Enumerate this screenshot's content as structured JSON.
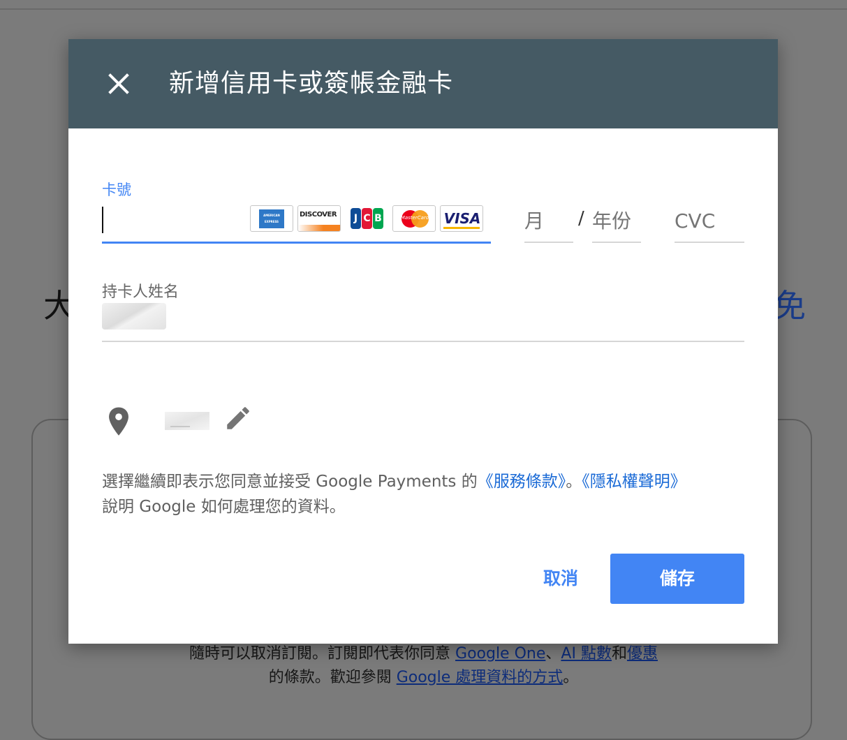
{
  "background": {
    "heading_left": "大",
    "heading_right": "免",
    "footer_line1_prefix": "隨時可以取消訂閱。訂閱即代表你同意 ",
    "footer_link_google_one": "Google One",
    "footer_sep1": "、",
    "footer_link_ai_points": "AI 點數",
    "footer_and": "和",
    "footer_link_offers": "優惠",
    "footer_line2_prefix": "的條款。歡迎參閱 ",
    "footer_link_data": "Google 處理資料的方式",
    "footer_line2_suffix": "。"
  },
  "dialog": {
    "title": "新增信用卡或簽帳金融卡",
    "close_icon": "close-icon",
    "card_number_label": "卡號",
    "card_logos": [
      "AMERICAN EXPRESS",
      "DISCOVER",
      "JCB",
      "MasterCard",
      "VISA"
    ],
    "month_placeholder": "月",
    "slash": "/",
    "year_placeholder": "年份",
    "cvc_placeholder": "CVC",
    "cardholder_label": "持卡人姓名",
    "terms_prefix": "選擇繼續即表示您同意並接受 Google Payments 的",
    "terms_link_service": "《服務條款》",
    "terms_mid": "。",
    "terms_link_privacy": "《隱私權聲明》",
    "terms_suffix": "說明 Google 如何處理您的資料。",
    "cancel_label": "取消",
    "save_label": "儲存"
  },
  "colors": {
    "header_bg": "#455a64",
    "accent": "#4285f4",
    "link": "#1a6ad6",
    "overlay": "#7b7b7b"
  }
}
